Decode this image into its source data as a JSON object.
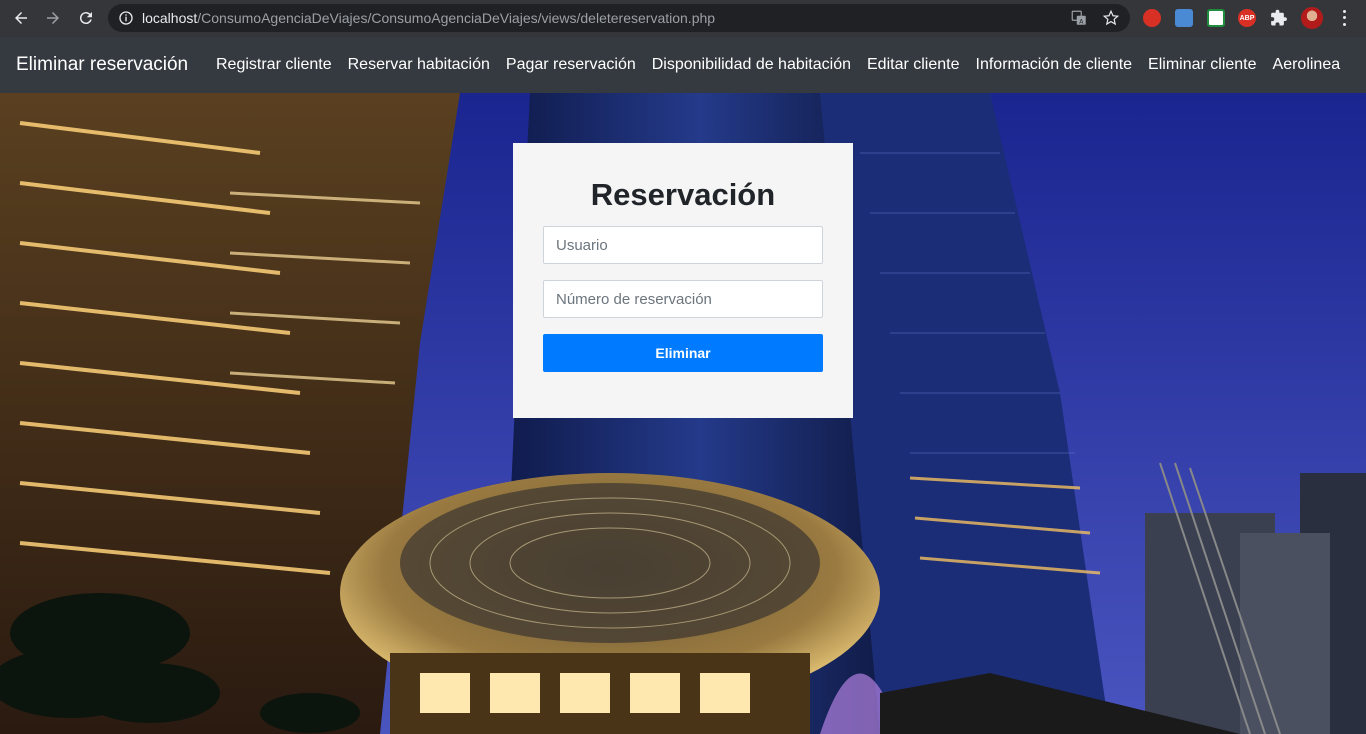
{
  "browser": {
    "url_host": "localhost",
    "url_path": "/ConsumoAgenciaDeViajes/ConsumoAgenciaDeViajes/views/deletereservation.php",
    "ext_abp_label": "ABP",
    "icons": [
      "back-icon",
      "forward-icon",
      "reload-icon",
      "info-icon",
      "translate-icon",
      "star-icon",
      "extensions-icon",
      "menu-icon"
    ]
  },
  "navbar": {
    "brand": "Eliminar reservación",
    "links": [
      {
        "label": "Registrar cliente"
      },
      {
        "label": "Reservar habitación"
      },
      {
        "label": "Pagar reservación"
      },
      {
        "label": "Disponibilidad de habitación"
      },
      {
        "label": "Editar cliente"
      },
      {
        "label": "Información de cliente"
      },
      {
        "label": "Eliminar cliente"
      },
      {
        "label": "Aerolinea"
      }
    ]
  },
  "form": {
    "title": "Reservación",
    "user_placeholder": "Usuario",
    "user_value": "",
    "reservation_placeholder": "Número de reservación",
    "reservation_value": "",
    "submit_label": "Eliminar"
  },
  "colors": {
    "navbar_bg": "#343a40",
    "primary_button": "#007bff",
    "card_bg": "#f5f5f5"
  }
}
